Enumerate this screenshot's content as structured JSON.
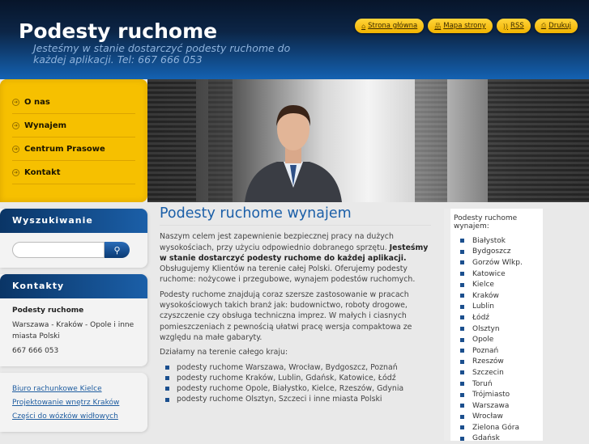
{
  "header": {
    "title": "Podesty ruchome",
    "slogan": "Jesteśmy w stanie dostarczyć podesty ruchome do każdej aplikacji. Tel: 667 666 053",
    "links": [
      {
        "label": "Strona główna",
        "icon": "home-icon"
      },
      {
        "label": "Mapa strony",
        "icon": "sitemap-icon"
      },
      {
        "label": "RSS",
        "icon": "rss-icon"
      },
      {
        "label": "Drukuj",
        "icon": "print-icon"
      }
    ]
  },
  "menu": [
    "O nas",
    "Wynajem",
    "Centrum Prasowe",
    "Kontakt"
  ],
  "sidebar": {
    "search_title": "Wyszukiwanie",
    "search_value": "",
    "contact_title": "Kontakty",
    "contact_name": "Podesty ruchome",
    "contact_address": "Warszawa - Kraków - Opole i inne miasta Polski",
    "contact_phone": "667 666 053",
    "links": [
      "Biuro rachunkowe Kielce",
      "Projektowanie wnętrz Kraków",
      "Części do wózków widłowych"
    ]
  },
  "main": {
    "title": "Podesty ruchome wynajem",
    "p1a": "Naszym celem jest zapewnienie bezpiecznej pracy na dużych wysokościach, przy użyciu odpowiednio dobranego sprzętu. ",
    "p1b": "Jesteśmy w stanie dostarczyć podesty ruchome do każdej aplikacji.",
    "p1c": " Obsługujemy Klientów na terenie całej Polski. Oferujemy podesty ruchome: nożycowe i przegubowe, wynajem podestów ruchomych.",
    "p2": "Podesty ruchome znajdują coraz szersze zastosowanie w pracach wysokościowych takich branż jak: budownictwo, roboty drogowe, czyszczenie czy obsługa techniczna imprez. W małych i ciasnych pomieszczeniach z pewnością ułatwi pracę wersja compaktowa ze względu na małe gabaryty.",
    "p3": "Działamy na terenie całego kraju:",
    "list": [
      "podesty ruchome Warszawa, Wrocław, Bydgoszcz, Poznań",
      "podesty ruchome Kraków, Lublin, Gdańsk, Katowice, Łódź",
      "podesty ruchome Opole, Białystko, Kielce, Rzeszów, Gdynia",
      "podesty ruchome Olsztyn, Szczeci i inne miasta Polski"
    ]
  },
  "right": {
    "title": "Podesty ruchome wynajem:",
    "cities": [
      "Białystok",
      "Bydgoszcz",
      "Gorzów Wlkp.",
      "Katowice",
      "Kielce",
      "Kraków",
      "Lublin",
      "Łódź",
      "Olsztyn",
      "Opole",
      "Poznań",
      "Rzeszów",
      "Szczecin",
      "Toruń",
      "Trójmiasto",
      "Warszawa",
      "Wrocław",
      "Zielona Góra",
      "Gdańsk"
    ]
  }
}
